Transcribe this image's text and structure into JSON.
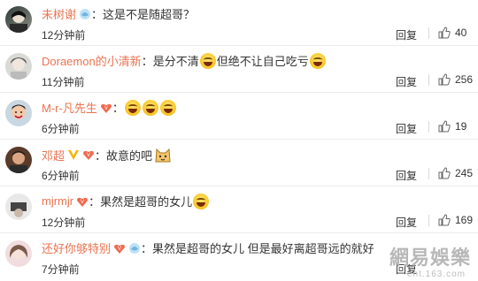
{
  "comments": [
    {
      "name": "未树谢",
      "badges": [
        "lotus"
      ],
      "text": "：这是不是随超哥？",
      "emojis": 0,
      "time": "12分钟前",
      "reply": "回复",
      "likes": "40"
    },
    {
      "name": "Doraemon的小清新",
      "badges": [],
      "text": "：是分不清",
      "text2": "但绝不让自己吃亏",
      "emojis": 0,
      "time": "11分钟前",
      "reply": "回复",
      "likes": "256"
    },
    {
      "name": "M-r-凡先生",
      "badges": [
        "vip"
      ],
      "text": "：",
      "emojis": 3,
      "time": "6分钟前",
      "reply": "回复",
      "likes": "19"
    },
    {
      "name": "邓超",
      "badges": [
        "verified",
        "vip"
      ],
      "text": "：故意的吧",
      "time": "6分钟前",
      "reply": "回复",
      "likes": "245"
    },
    {
      "name": "mjrmjr",
      "badges": [
        "vip"
      ],
      "text": "：果然是超哥的女儿",
      "time": "12分钟前",
      "reply": "回复",
      "likes": "169"
    },
    {
      "name": "还好你够特别",
      "badges": [
        "vip",
        "lotus"
      ],
      "text": "：果然是超哥的女儿 但是最好离超哥远的就好",
      "time": "7分钟前",
      "reply": "回复",
      "likes": ""
    }
  ],
  "watermark": {
    "line1": "網易娛樂",
    "line2": "ent.163.com"
  },
  "colors": {
    "name": "#eb7350",
    "text": "#333333"
  }
}
